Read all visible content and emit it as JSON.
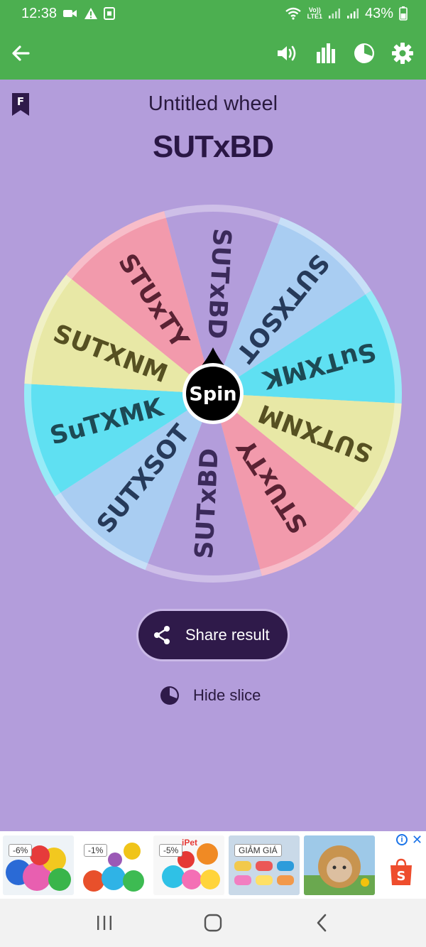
{
  "status_bar": {
    "time": "12:38",
    "battery": "43%",
    "network_label_top": "Vo))",
    "network_label_bottom": "LTE1"
  },
  "app_bar": {
    "icons": [
      "back-arrow-icon",
      "volume-icon",
      "bar-chart-icon",
      "pie-chart-icon",
      "settings-icon"
    ]
  },
  "wheel": {
    "name": "Untitled wheel",
    "result": "SUTxBD",
    "center_label": "Spin",
    "slices": [
      {
        "label": "SUTxBD",
        "color": "#b39ddb",
        "text_color": "#3b2a5a"
      },
      {
        "label": "SUTXSOT",
        "color": "#a9cdf2",
        "text_color": "#263a5a"
      },
      {
        "label": "SuTXMK",
        "color": "#5fe0f2",
        "text_color": "#1d4a55"
      },
      {
        "label": "SUTXNM",
        "color": "#e8e8a6",
        "text_color": "#565022"
      },
      {
        "label": "STUxTY",
        "color": "#f29aac",
        "text_color": "#5a2233"
      },
      {
        "label": "SUTxBD",
        "color": "#b39ddb",
        "text_color": "#3b2a5a"
      },
      {
        "label": "SUTXSOT",
        "color": "#a9cdf2",
        "text_color": "#263a5a"
      },
      {
        "label": "SuTXMK",
        "color": "#5fe0f2",
        "text_color": "#1d4a55"
      },
      {
        "label": "SUTXNM",
        "color": "#e8e8a6",
        "text_color": "#565022"
      },
      {
        "label": "STUxTY",
        "color": "#f29aac",
        "text_color": "#5a2233"
      }
    ]
  },
  "actions": {
    "share_label": "Share result",
    "hide_label": "Hide slice"
  },
  "ad": {
    "items": [
      {
        "tag": "-6%"
      },
      {
        "tag": "-1%"
      },
      {
        "tag": "-5%",
        "brand": "iPet"
      },
      {
        "tag": "GIẢM GIÁ"
      },
      {
        "tag": ""
      }
    ],
    "shop_letter": "S",
    "info": "i",
    "close": "✕"
  },
  "colors": {
    "green": "#4caf50",
    "background": "#b39ddb",
    "dark_purple": "#2f1a4a"
  }
}
